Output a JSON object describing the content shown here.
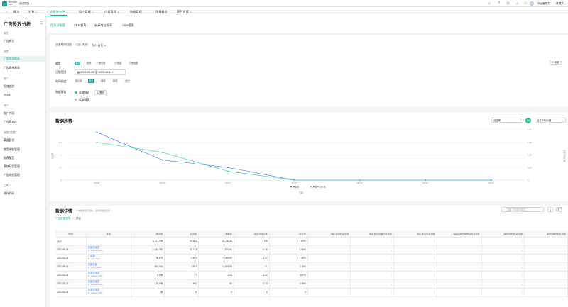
{
  "app": {
    "logo_text": "SENSORS\nDATA",
    "name": "测试项目 ⌄"
  },
  "topbar": {
    "user_name": "平台管理员",
    "user_role": "管理员 ⌄"
  },
  "nav": [
    {
      "label": "概览",
      "active": false
    },
    {
      "label": "分析 ⌄",
      "active": false
    },
    {
      "label": "广告投放分析 ⌄",
      "active": true
    },
    {
      "label": "用户管理 ⌄",
      "active": false
    },
    {
      "label": "内容管理 ⌄",
      "active": false
    },
    {
      "label": "数据管理",
      "active": false
    },
    {
      "label": "场景概览",
      "active": false
    },
    {
      "label": "项目设置 ⌄",
      "active": false
    }
  ],
  "sidebar": {
    "title": "广告投放分析",
    "collapse_glyph": "☰",
    "groups": [
      {
        "label": "概览",
        "items": [
          {
            "label": "广告概览",
            "active": false
          }
        ]
      },
      {
        "label": "报表",
        "items": [
          {
            "label": "广告投放报表",
            "active": true
          },
          {
            "label": "广告素材报表",
            "active": false
          }
        ]
      },
      {
        "label": "推广",
        "items": [
          {
            "label": "投放追踪",
            "active": false
          },
          {
            "label": "SLink",
            "active": false
          }
        ]
      },
      {
        "label": "资产",
        "items": [
          {
            "label": "推广内容",
            "active": false
          },
          {
            "label": "广告素材库",
            "active": false
          }
        ]
      },
      {
        "label": "管理与配置",
        "items": [
          {
            "label": "渠道管理",
            "active": false
          },
          {
            "label": "常用参数管理",
            "active": false
          },
          {
            "label": "报表配置",
            "active": false
          },
          {
            "label": "素材标签管理",
            "active": false
          },
          {
            "label": "广告授权管理",
            "active": false
          }
        ]
      },
      {
        "label": "工具",
        "items": [
          {
            "label": "海外代码",
            "active": false
          }
        ]
      }
    ]
  },
  "tabs": [
    {
      "label": "信息流报表",
      "active": true
    },
    {
      "label": "SEM报表",
      "active": false
    },
    {
      "label": "安卓商店报表",
      "active": false
    },
    {
      "label": "ASA报表",
      "active": false
    }
  ],
  "filters": {
    "attribution_label": "点击时间归因",
    "attribution_state": "关闭",
    "stat_method": "统计方式 ⌄",
    "refresh_label": "↻ 刷新",
    "dimension_label": "维度",
    "dimension_chips": [
      {
        "label": "渠道",
        "active": true
      },
      {
        "label": "账号",
        "active": false
      },
      {
        "label": "广告计划",
        "active": false
      },
      {
        "label": "广告组",
        "active": false
      },
      {
        "label": "广告创意",
        "active": false
      }
    ],
    "date_label": "日期范围",
    "date_value": "2022-05-05 至 2022-06-11",
    "granularity_label": "时间维度",
    "granularity_chips": [
      {
        "label": "按小时",
        "active": false
      },
      {
        "label": "按天",
        "active": true
      },
      {
        "label": "按周",
        "active": false
      },
      {
        "label": "按月",
        "active": false
      },
      {
        "label": "合计",
        "active": false
      }
    ],
    "filter_label": "数据筛选",
    "radio_options": [
      {
        "label": "渠道筛选",
        "checked": true
      },
      {
        "label": "渠道搜索",
        "checked": false
      }
    ],
    "filter_button": "⇅ 筛选"
  },
  "trend": {
    "title": "数据趋势",
    "metric_left": "点击率",
    "vs_label": "VS",
    "metric_right": "点击平均价格"
  },
  "chart_data": {
    "type": "line",
    "x": [
      "05-05",
      "05-06",
      "05-07",
      "05-08",
      "05-09",
      "05-10",
      "05-11"
    ],
    "series": [
      {
        "name": "点击率",
        "color": "#3b6fd6",
        "axis": "left",
        "values": [
          1.9,
          0.8,
          0.5,
          0,
          0,
          0,
          0
        ]
      },
      {
        "name": "点击平均价格",
        "color": "#3ac49b",
        "axis": "right",
        "values": [
          1.5,
          1.1,
          0.35,
          0,
          0,
          0,
          0
        ]
      }
    ],
    "ylabel_left": "点击率",
    "ylabel_right": "点击平均价格",
    "yticks_left": [
      "0",
      "0.5",
      "1",
      "1.5",
      "2"
    ],
    "yticks_right": [
      "0",
      "0.50",
      "1.00",
      "1.50",
      "2.00"
    ],
    "ylim_left": [
      0,
      2
    ],
    "ylim_right": [
      0,
      2
    ],
    "legend_position": "bottom",
    "xaxis_name": "日期"
  },
  "detail": {
    "title": "数据详情",
    "hint": "广告数据最近更新，请内容描述设置",
    "search_placeholder": "请输入渠道关键词",
    "download_glyph": "⤓",
    "filter_glyph": "⊽",
    "breadcrumb_first": "广告投放报表",
    "breadcrumb_sep": "/",
    "breadcrumb_second": "渠道",
    "columns": [
      "时间",
      "渠道",
      "展示数",
      "点击数",
      "消耗量",
      "点击平均价格",
      "点击率",
      "App 活动的点击数",
      "App 首充页面的点击数",
      "App 激活的点击数",
      "$AdClickRanking的点击数",
      "getCode3的点击数",
      "getCode3的点击数"
    ],
    "rows": [
      {
        "date": "合计",
        "channel": "",
        "channel_sub": "",
        "cells": [
          "2,274,195",
          "41,583",
          "20,730.38",
          "0.5",
          "1.83%",
          "-",
          "-",
          "-",
          "-",
          "-",
          "-"
        ]
      },
      {
        "date": "2022-05-05",
        "channel": "巨量信息流",
        "channel_sub": "ID: tiaotiao_track1",
        "cells": [
          "1,616,387",
          "31,733",
          "2,570.94",
          "0.16",
          "1.96%",
          "-",
          "-",
          "-",
          "-",
          "-",
          "-"
        ]
      },
      {
        "date": "2022-05-05",
        "channel": "广点通",
        "channel_sub": "ID: mp8_track1",
        "cells": [
          "98,675",
          "1,452",
          "5,169.59",
          "4.27",
          "1.48%",
          "-",
          "-",
          "-",
          "-",
          "-",
          "-"
        ]
      },
      {
        "date": "2022-05-06",
        "channel": "百度信息",
        "channel_sub": "ID: baidu_track1",
        "cells": [
          "361,016",
          "7,697",
          "8,676.63",
          "1.1",
          "2.15%",
          "-",
          "-",
          "-",
          "-",
          "-",
          "-"
        ]
      },
      {
        "date": "2022-05-06",
        "channel": "巨量信息流",
        "channel_sub": "ID: tiaotiao_track1",
        "cells": [
          "2,098",
          "77",
          "0.34",
          "0.32",
          "3.61%",
          "-",
          "-",
          "-",
          "-",
          "-",
          "-"
        ]
      },
      {
        "date": "2022-05-07",
        "channel": "巨量信息流",
        "channel_sub": "ID: tiaotiao_track1",
        "cells": [
          "129,195",
          "494",
          "59",
          "0.13",
          "0.35%",
          "-",
          "-",
          "-",
          "-",
          "-",
          "-"
        ]
      },
      {
        "date": "2022-05-08",
        "channel": "巨量信息流",
        "channel_sub": "ID: tiaotiao_track1",
        "cells": [
          "35",
          "0",
          "0",
          "0",
          "0",
          "-",
          "-",
          "-",
          "-",
          "-",
          "-"
        ]
      }
    ]
  }
}
